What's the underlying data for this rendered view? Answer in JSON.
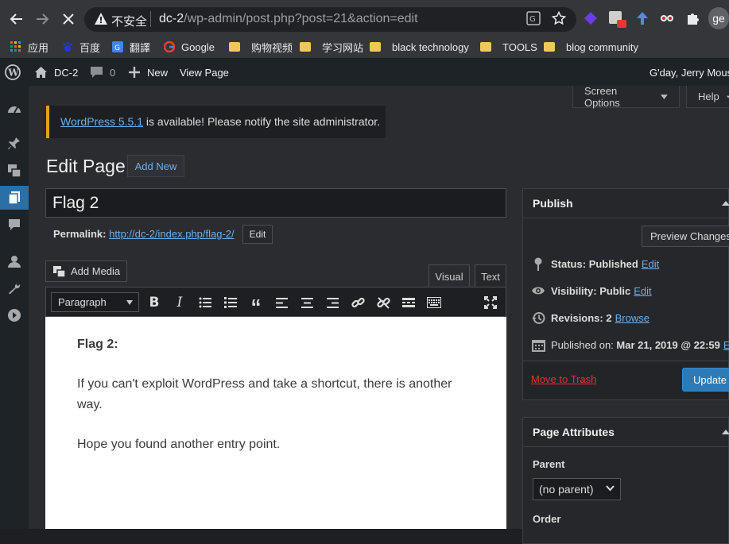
{
  "browser": {
    "insecure_label": "不安全",
    "url_host": "dc-2",
    "url_path": "/wp-admin/post.php?post=21&action=edit",
    "profile_initials": "ge"
  },
  "bookmarks": [
    {
      "label": "应用",
      "icon": "apps-grid-icon"
    },
    {
      "label": "百度",
      "icon": "baidu-icon"
    },
    {
      "label": "翻譯",
      "icon": "translate-icon"
    },
    {
      "label": "Google",
      "icon": "google-icon"
    },
    {
      "label": "购物视频",
      "icon": "folder-icon"
    },
    {
      "label": "学习网站",
      "icon": "folder-icon"
    },
    {
      "label": "black technology",
      "icon": "folder-icon"
    },
    {
      "label": "TOOLS",
      "icon": "folder-icon"
    },
    {
      "label": "blog community",
      "icon": "folder-icon"
    }
  ],
  "adminbar": {
    "site_name": "DC-2",
    "comments_count": "0",
    "new_label": "New",
    "view_page_label": "View Page",
    "greeting": "G'day, Jerry Mous"
  },
  "screen_options_label": "Screen Options",
  "help_label": "Help",
  "notice": {
    "link_text": "WordPress 5.5.1",
    "rest_text": " is available! Please notify the site administrator."
  },
  "page": {
    "heading": "Edit Page",
    "add_new_label": "Add New",
    "title_value": "Flag 2",
    "permalink_label": "Permalink:",
    "permalink_url": "http://dc-2/index.php/flag-2/",
    "permalink_edit_label": "Edit"
  },
  "editor": {
    "add_media_label": "Add Media",
    "tab_visual": "Visual",
    "tab_text": "Text",
    "format_value": "Paragraph",
    "content_heading": "Flag 2:",
    "content_p1": "If you can't exploit WordPress and take a shortcut, there is another way.",
    "content_p2": "Hope you found another entry point."
  },
  "publish": {
    "title": "Publish",
    "preview_label": "Preview Changes",
    "status_label": "Status:",
    "status_value": "Published",
    "visibility_label": "Visibility:",
    "visibility_value": "Public",
    "revisions_label": "Revisions:",
    "revisions_value": "2",
    "browse_label": "Browse",
    "published_on_label": "Published on:",
    "published_on_value": "Mar 21, 2019 @ 22:59",
    "edit_label": "Edit",
    "edit_label_cut": "Ed",
    "trash_label": "Move to Trash",
    "update_label": "Update"
  },
  "page_attributes": {
    "title": "Page Attributes",
    "parent_label": "Parent",
    "parent_value": "(no parent)",
    "order_label": "Order"
  }
}
